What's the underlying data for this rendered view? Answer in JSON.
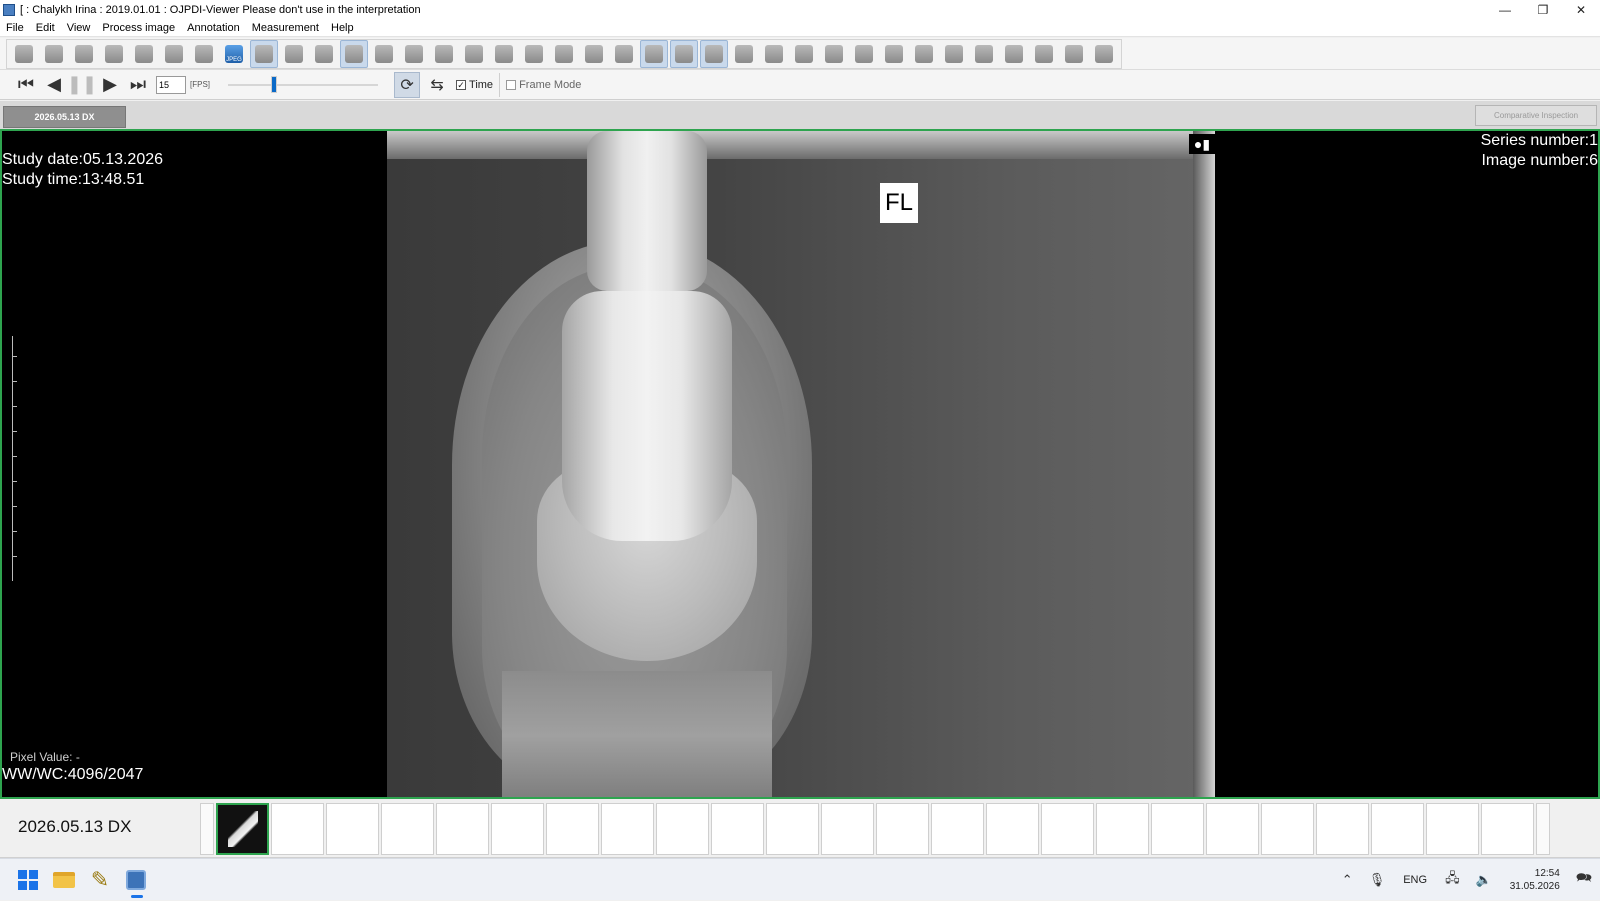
{
  "window": {
    "title": "[ : Chalykh Irina : 2019.01.01 : OJPDI-Viewer  Please don't use in the interpretation",
    "minimize_icon": "minimize-icon",
    "maximize_icon": "restore-icon",
    "close_icon": "close-icon"
  },
  "menu": [
    "File",
    "Edit",
    "View",
    "Process image",
    "Annotation",
    "Measurement",
    "Help"
  ],
  "toolbar": {
    "buttons": [
      "layout",
      "find",
      "user",
      "user-export",
      "print",
      "print-settings",
      "copy",
      "jpeg-export",
      "grid",
      "copy-image",
      "table",
      "patient",
      "print-preview",
      "info",
      "note",
      "window-level",
      "invert",
      "crop",
      "pan",
      "zoom",
      "rotate",
      "single-view",
      "dicom-settings",
      "tools",
      "eraser",
      "pixel",
      "body1",
      "body2",
      "body3",
      "body4",
      "line",
      "text",
      "ruler",
      "angle",
      "rect",
      "ellipse",
      "roi"
    ],
    "jpeg_label": "JPEG"
  },
  "playback": {
    "fps_value": "15",
    "fps_label": "[FPS]",
    "speed_level": 0.3,
    "time_label": "Time",
    "time_checked": true,
    "frame_mode_label": "Frame Mode",
    "frame_mode_checked": false
  },
  "tabs": {
    "active": "2026.05.13 DX",
    "comparative_inspection": "Comparative Inspection"
  },
  "viewer": {
    "study_date": "Study date:05.13.2026",
    "study_time": "Study time:13:48.51",
    "series_number": "Series number:1",
    "image_number": "Image number:6",
    "pixel_value": "Pixel Value:   -",
    "wwwc": "WW/WC:4096/2047",
    "marker": "FL",
    "orientation_icon": "orientation-icon"
  },
  "thumbnails": {
    "series_label": "2026.05.13 DX",
    "count": 24,
    "selected_index": 0
  },
  "taskbar": {
    "language": "ENG",
    "time": "12:54",
    "date": "31.05.2026"
  }
}
